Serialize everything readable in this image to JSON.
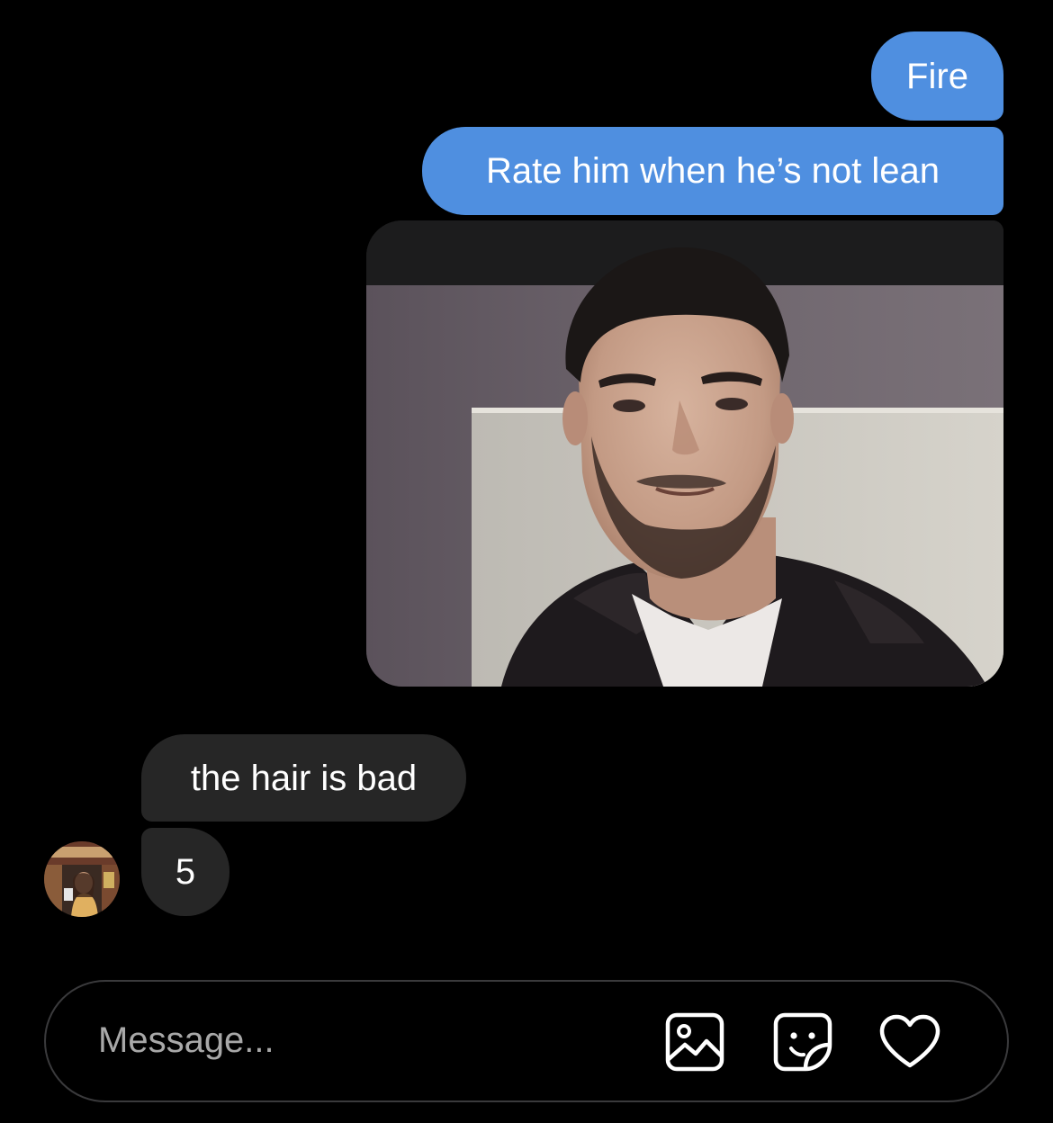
{
  "messages": {
    "sent_1": "Fire",
    "sent_2": "Rate him when he’s not lean",
    "received_1": "the hair is bad",
    "received_2": "5"
  },
  "composer": {
    "placeholder": "Message..."
  },
  "icons": {
    "gallery": "image-icon",
    "sticker": "sticker-icon",
    "like": "heart-icon"
  },
  "colors": {
    "background": "#000000",
    "sent_bubble": "#4f8fe0",
    "received_bubble": "#262626"
  }
}
